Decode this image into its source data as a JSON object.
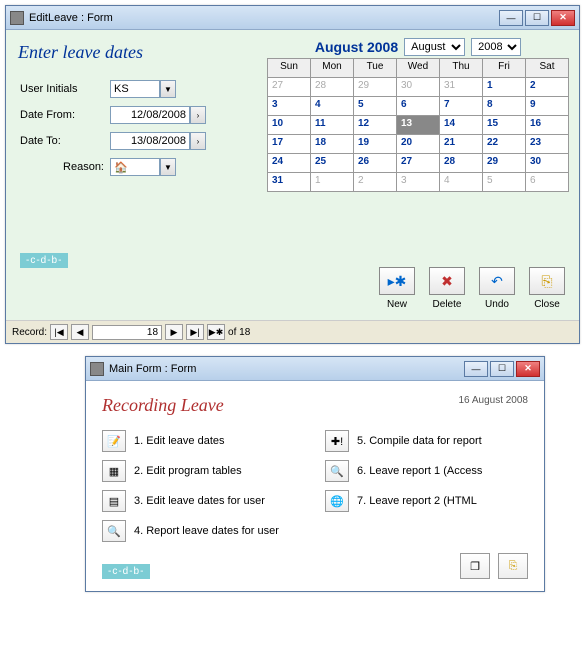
{
  "win1": {
    "title": "EditLeave : Form",
    "heading": "Enter leave dates",
    "labels": {
      "userInitials": "User Initials",
      "dateFrom": "Date From:",
      "dateTo": "Date To:",
      "reason": "Reason:"
    },
    "values": {
      "userInitials": "KS",
      "dateFrom": "12/08/2008",
      "dateTo": "13/08/2008",
      "reason": "🏠"
    },
    "calendar": {
      "title": "August 2008",
      "monthSel": "August",
      "yearSel": "2008",
      "days": [
        "Sun",
        "Mon",
        "Tue",
        "Wed",
        "Thu",
        "Fri",
        "Sat"
      ],
      "rows": [
        [
          {
            "n": "27",
            "c": "muted"
          },
          {
            "n": "28",
            "c": "muted"
          },
          {
            "n": "29",
            "c": "muted"
          },
          {
            "n": "30",
            "c": "muted"
          },
          {
            "n": "31",
            "c": "muted"
          },
          {
            "n": "1",
            "c": "active"
          },
          {
            "n": "2",
            "c": "active"
          }
        ],
        [
          {
            "n": "3",
            "c": "active"
          },
          {
            "n": "4",
            "c": "active"
          },
          {
            "n": "5",
            "c": "active"
          },
          {
            "n": "6",
            "c": "active"
          },
          {
            "n": "7",
            "c": "active"
          },
          {
            "n": "8",
            "c": "active"
          },
          {
            "n": "9",
            "c": "active"
          }
        ],
        [
          {
            "n": "10",
            "c": "active"
          },
          {
            "n": "11",
            "c": "active"
          },
          {
            "n": "12",
            "c": "active"
          },
          {
            "n": "13",
            "c": "sel"
          },
          {
            "n": "14",
            "c": "active"
          },
          {
            "n": "15",
            "c": "active"
          },
          {
            "n": "16",
            "c": "active"
          }
        ],
        [
          {
            "n": "17",
            "c": "active"
          },
          {
            "n": "18",
            "c": "active"
          },
          {
            "n": "19",
            "c": "active"
          },
          {
            "n": "20",
            "c": "active"
          },
          {
            "n": "21",
            "c": "active"
          },
          {
            "n": "22",
            "c": "active"
          },
          {
            "n": "23",
            "c": "active"
          }
        ],
        [
          {
            "n": "24",
            "c": "active"
          },
          {
            "n": "25",
            "c": "active"
          },
          {
            "n": "26",
            "c": "active"
          },
          {
            "n": "27",
            "c": "active"
          },
          {
            "n": "28",
            "c": "active"
          },
          {
            "n": "29",
            "c": "active"
          },
          {
            "n": "30",
            "c": "active"
          }
        ],
        [
          {
            "n": "31",
            "c": "active"
          },
          {
            "n": "1",
            "c": "muted"
          },
          {
            "n": "2",
            "c": "muted"
          },
          {
            "n": "3",
            "c": "muted"
          },
          {
            "n": "4",
            "c": "muted"
          },
          {
            "n": "5",
            "c": "muted"
          },
          {
            "n": "6",
            "c": "muted"
          }
        ]
      ]
    },
    "cdb": "-c-d-b-",
    "actions": {
      "newIcon": "▸✱",
      "newLabel": "New",
      "deleteIcon": "✖",
      "deleteLabel": "Delete",
      "undoIcon": "↶",
      "undoLabel": "Undo",
      "closeIcon": "⎘",
      "closeLabel": "Close"
    },
    "record": {
      "label": "Record:",
      "first": "|◀",
      "prev": "◀",
      "value": "18",
      "next": "▶",
      "last": "▶|",
      "new": "▶✱",
      "of": "of  18"
    }
  },
  "win2": {
    "title": "Main Form : Form",
    "heading": "Recording Leave",
    "date": "16 August 2008",
    "items": [
      {
        "icon": "📝",
        "text": "1. Edit leave dates"
      },
      {
        "icon": "▦",
        "text": "2. Edit program tables"
      },
      {
        "icon": "▤",
        "text": "3. Edit leave dates for user"
      },
      {
        "icon": "🔍",
        "text": "4. Report leave dates for user"
      },
      {
        "icon": "✚!",
        "text": "5. Compile data for report"
      },
      {
        "icon": "🔍",
        "text": "6. Leave report 1 (Access"
      },
      {
        "icon": "🌐",
        "text": "7. Leave report 2 (HTML"
      }
    ],
    "cdb": "-c-d-b-",
    "bottomIcons": {
      "copy": "❐",
      "close": "⎘"
    }
  }
}
